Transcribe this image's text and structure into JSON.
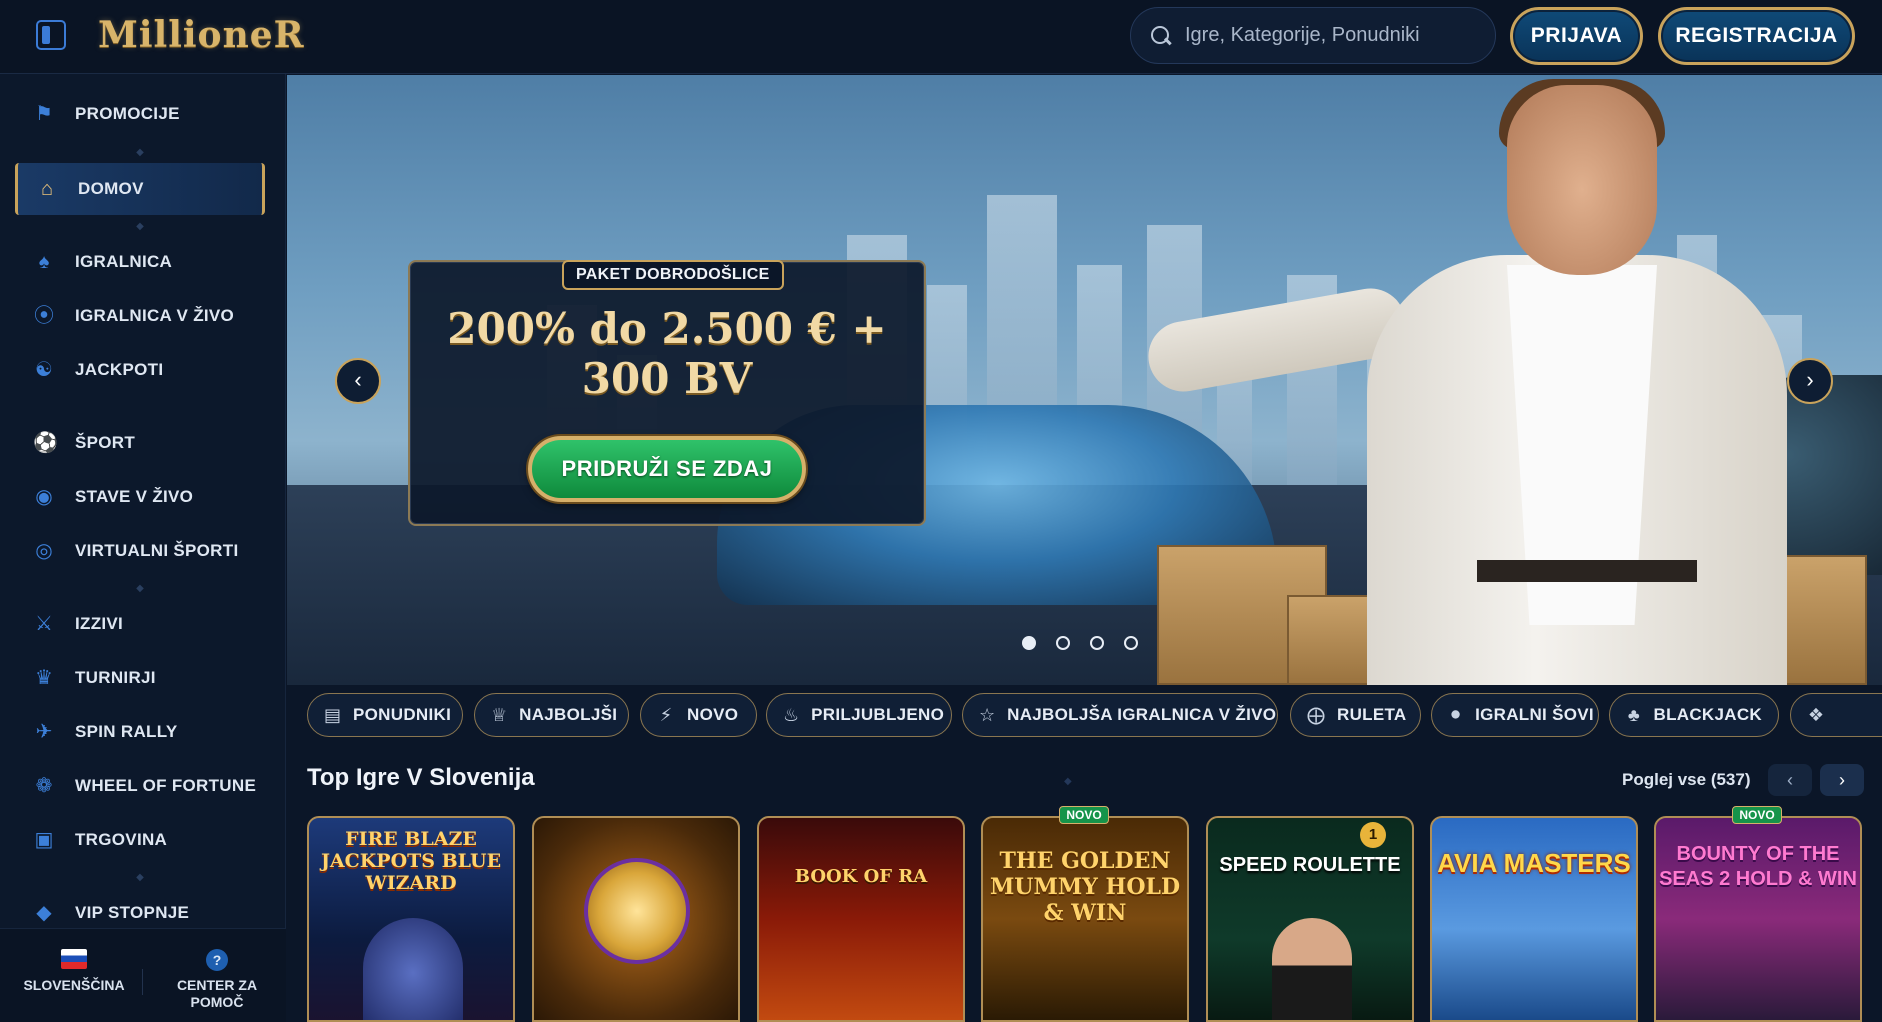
{
  "header": {
    "logo": "MillioneR",
    "search_placeholder": "Igre, Kategorije, Ponudniki",
    "login_label": "PRIJAVA",
    "register_label": "REGISTRACIJA"
  },
  "sidebar": {
    "items": [
      {
        "label": "PROMOCIJE",
        "icon": "megaphone-icon"
      },
      {
        "label": "DOMOV",
        "icon": "home-icon"
      },
      {
        "label": "IGRALNICA",
        "icon": "spade-icon"
      },
      {
        "label": "IGRALNICA V ŽIVO",
        "icon": "chip-icon"
      },
      {
        "label": "JACKPOTI",
        "icon": "jackpot-icon"
      },
      {
        "label": "ŠPORT",
        "icon": "football-icon"
      },
      {
        "label": "STAVE V ŽIVO",
        "icon": "live-bet-icon"
      },
      {
        "label": "VIRTUALNI ŠPORTI",
        "icon": "virtual-sport-icon"
      },
      {
        "label": "IZZIVI",
        "icon": "crossed-swords-icon"
      },
      {
        "label": "TURNIRJI",
        "icon": "trophy-icon"
      },
      {
        "label": "SPIN RALLY",
        "icon": "rally-icon"
      },
      {
        "label": "WHEEL OF FORTUNE",
        "icon": "wheel-icon"
      },
      {
        "label": "TRGOVINA",
        "icon": "basket-icon"
      },
      {
        "label": "VIP STOPNJE",
        "icon": "diamond-icon"
      }
    ],
    "language": "SLOVENŠČINA",
    "help": "CENTER ZA POMOČ"
  },
  "hero": {
    "badge": "PAKET DOBRODOŠLICE",
    "title": "200% do 2.500 € + 300 BV",
    "cta": "PRIDRUŽI SE ZDAJ",
    "slides": 4,
    "active_slide": 1
  },
  "categories": [
    {
      "label": "PONUDNIKI",
      "icon": "providers-icon"
    },
    {
      "label": "NAJBOLJŠI",
      "icon": "crown-icon"
    },
    {
      "label": "NOVO",
      "icon": "lightning-icon"
    },
    {
      "label": "PRILJUBLJENO",
      "icon": "flame-icon"
    },
    {
      "label": "NAJBOLJŠA IGRALNICA V ŽIVO",
      "icon": "star-icon"
    },
    {
      "label": "RULETA",
      "icon": "roulette-icon"
    },
    {
      "label": "IGRALNI ŠOVI",
      "icon": "microphone-icon"
    },
    {
      "label": "BLACKJACK",
      "icon": "cards-icon"
    }
  ],
  "top_games": {
    "title": "Top Igre V Slovenija",
    "view_all": "Poglej vse (537)",
    "games": [
      {
        "title": "FIRE BLAZE JACKPOTS BLUE WIZARD",
        "new": false
      },
      {
        "title": "",
        "new": false
      },
      {
        "title": "BOOK OF RA",
        "new": false
      },
      {
        "title": "THE GOLDEN MUMMY HOLD & WIN",
        "new": true,
        "badge": "NOVO"
      },
      {
        "title": "SPEED ROULETTE",
        "new": false,
        "rank": "1"
      },
      {
        "title": "AVIA MASTERS",
        "new": false
      },
      {
        "title": "BOUNTY OF THE SEAS 2 HOLD & WIN",
        "new": true,
        "badge": "NOVO"
      }
    ]
  }
}
